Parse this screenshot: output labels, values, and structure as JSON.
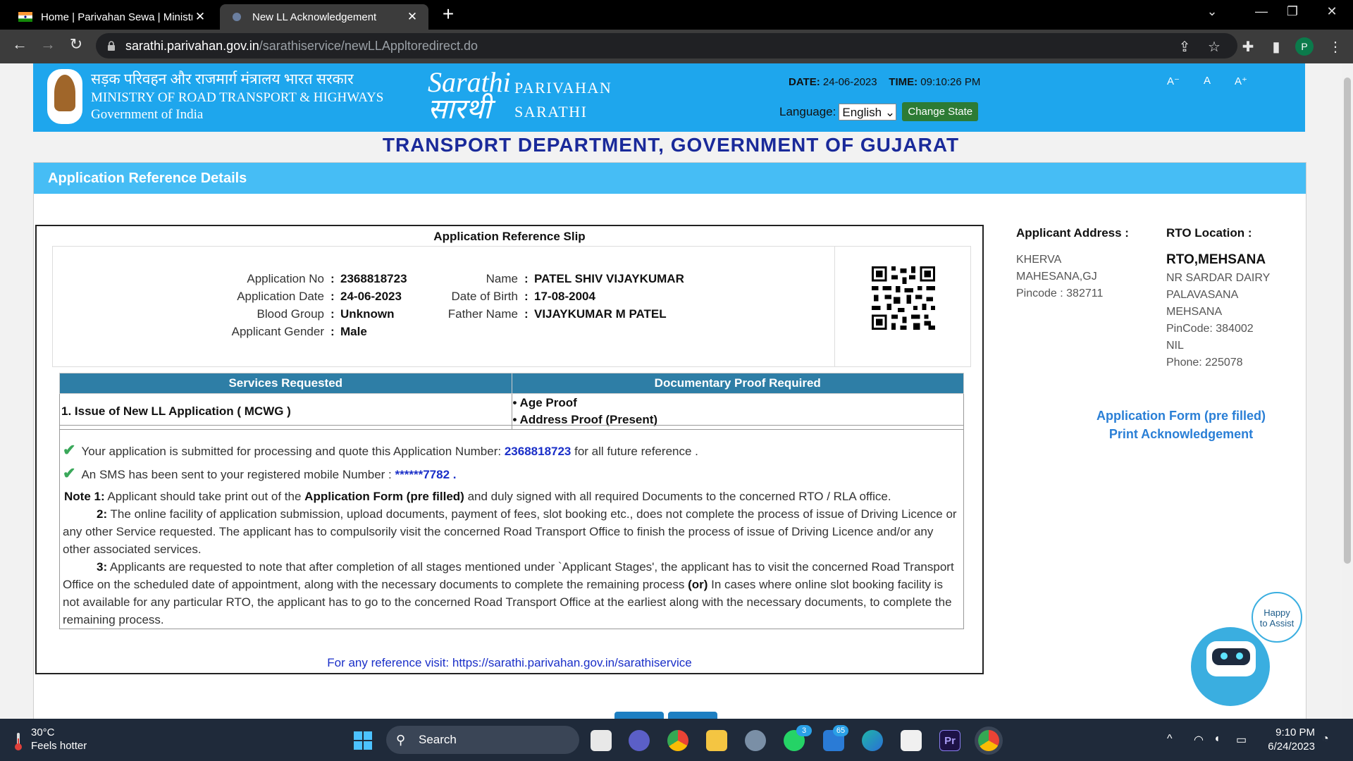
{
  "browser": {
    "tabs": [
      {
        "title": "Home | Parivahan Sewa | Ministry",
        "active": false
      },
      {
        "title": "New LL Acknowledgement",
        "active": true
      }
    ],
    "url_domain": "sarathi.parivahan.gov.in",
    "url_path": "/sarathiservice/newLLAppltoredirect.do",
    "profile_initial": "P"
  },
  "header": {
    "hindi_line": "सड़क परिवहन और राजमार्ग मंत्रालय भारत सरकार",
    "ministry_line": "MINISTRY OF ROAD TRANSPORT & HIGHWAYS",
    "gov_line": "Government of India",
    "logo_script": "Sarathi",
    "logo_hindi": "सारथी",
    "brand_line1": "PARIVAHAN",
    "brand_line2": "SARATHI",
    "date_label": "DATE:",
    "date_value": "24-06-2023",
    "time_label": "TIME:",
    "time_value": "09:10:26 PM",
    "language_label": "Language:",
    "language_value": "English",
    "change_state_label": "Change State",
    "font_small": "A⁻",
    "font_normal": "A",
    "font_large": "A⁺"
  },
  "department_title": "TRANSPORT DEPARTMENT, GOVERNMENT OF GUJARAT",
  "panel_title": "Application Reference Details",
  "slip": {
    "title": "Application Reference Slip",
    "fields_left": [
      {
        "label": "Application No",
        "value": "2368818723"
      },
      {
        "label": "Application Date",
        "value": "24-06-2023"
      },
      {
        "label": "Blood Group",
        "value": "Unknown"
      },
      {
        "label": "Applicant Gender",
        "value": "Male"
      }
    ],
    "fields_right": [
      {
        "label": "Name",
        "value": "PATEL SHIV VIJAYKUMAR"
      },
      {
        "label": "Date of Birth",
        "value": "17-08-2004"
      },
      {
        "label": "Father Name",
        "value": "VIJAYKUMAR M PATEL"
      }
    ],
    "colon": ":",
    "services_header": "Services Requested",
    "proof_header": "Documentary Proof Required",
    "service": "1. Issue of New LL Application ( MCWG )",
    "proofs": [
      "• Age Proof",
      "• Address Proof (Present)"
    ],
    "msg1_pre": "Your application is submitted for processing and quote this Application Number:",
    "msg1_num": "2368818723",
    "msg1_post": "for all future reference .",
    "msg2_pre": "An SMS has been sent to your registered mobile Number :",
    "msg2_num": "******7782 .",
    "note1_label": "Note 1:",
    "note1_pre": "Applicant should take print out of the",
    "note1_bold": "Application Form (pre filled)",
    "note1_post": "and duly signed with all required Documents to the concerned RTO / RLA office.",
    "note2_label": "2:",
    "note2_text": "The online facility of application submission, upload documents, payment of fees, slot booking etc., does not complete the process of issue of Driving Licence or any other Service requested. The applicant has to compulsorily visit the concerned Road Transport Office to finish the process of issue of Driving Licence and/or any other associated services.",
    "note3_label": "3:",
    "note3_pre": "Applicants are requested to note that after completion of all stages mentioned under `Applicant Stages', the applicant has to visit the concerned Road Transport Office on the scheduled date of appointment, along with the necessary documents to complete the remaining process",
    "note3_bold": "(or)",
    "note3_post": "In cases where online slot booking facility is not available for any particular RTO, the applicant has to go to the concerned Road Transport Office at the earliest along with the necessary documents, to complete the remaining process.",
    "reference": "For any reference visit: https://sarathi.parivahan.gov.in/sarathiservice"
  },
  "address": {
    "heading": "Applicant Address :",
    "line1": "KHERVA",
    "line2": "MAHESANA,GJ",
    "line3": "Pincode : 382711"
  },
  "rto": {
    "heading": "RTO Location :",
    "name": "RTO,MEHSANA",
    "line1": "NR SARDAR DAIRY",
    "line2": "PALAVASANA",
    "line3": "MEHSANA",
    "line4": "PinCode:  384002",
    "line5": "NIL",
    "line6": "Phone:  225078"
  },
  "links": {
    "form": "Application Form (pre filled)",
    "ack": "Print Acknowledgement"
  },
  "assistant": {
    "line1": "Happy",
    "line2": "to Assist"
  },
  "taskbar": {
    "temperature": "30°C",
    "weather_desc": "Feels hotter",
    "search_label": "Search",
    "whatsapp_badge": "3",
    "mail_badge": "65",
    "time": "9:10 PM",
    "date": "6/24/2023"
  }
}
